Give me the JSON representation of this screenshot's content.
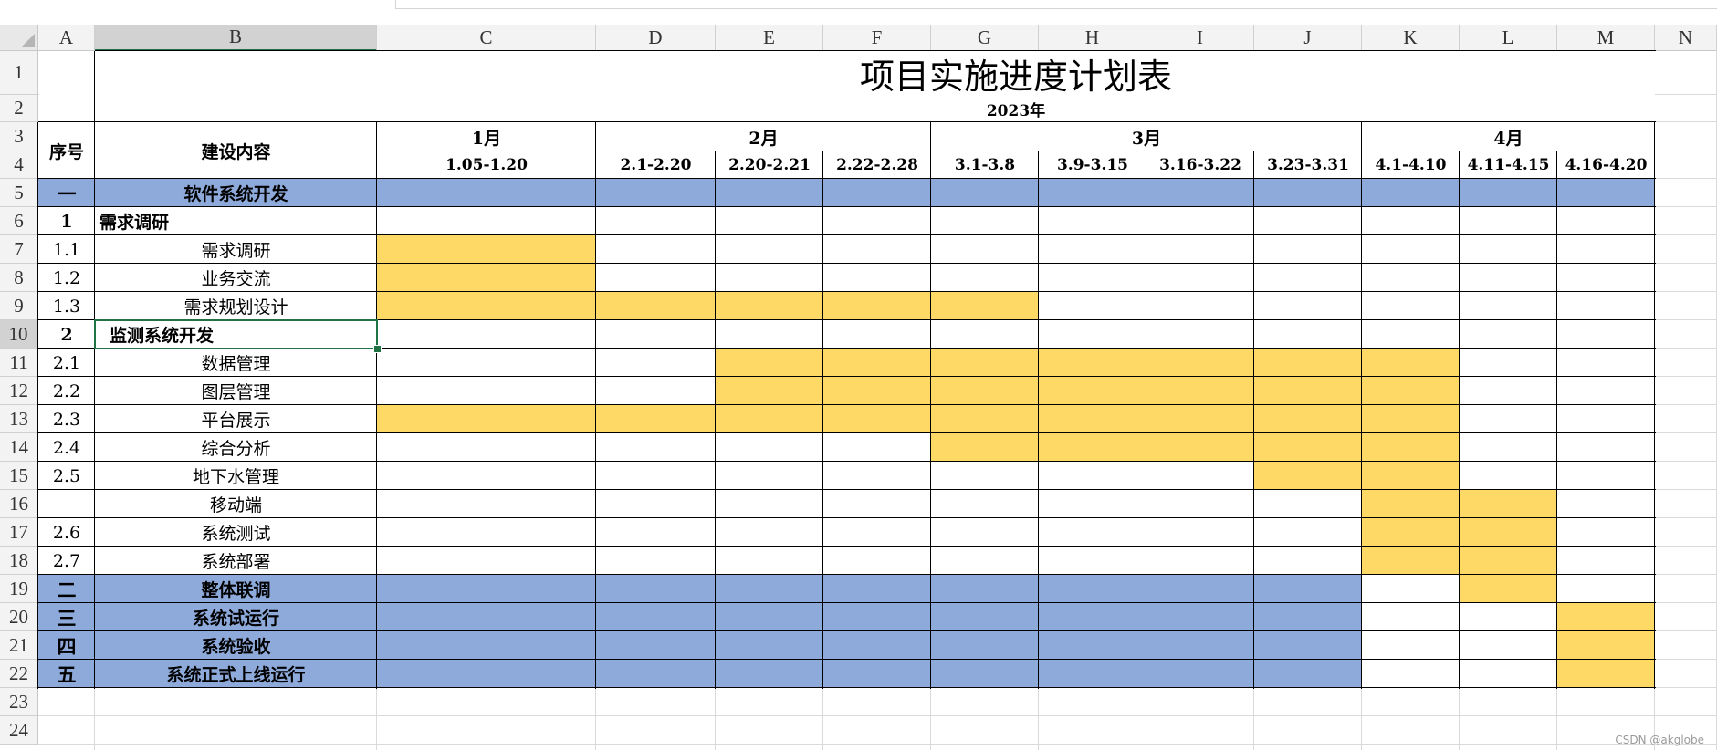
{
  "columns": [
    {
      "letter": "A"
    },
    {
      "letter": "B"
    },
    {
      "letter": "C"
    },
    {
      "letter": "D"
    },
    {
      "letter": "E"
    },
    {
      "letter": "F"
    },
    {
      "letter": "G"
    },
    {
      "letter": "H"
    },
    {
      "letter": "I"
    },
    {
      "letter": "J"
    },
    {
      "letter": "K"
    },
    {
      "letter": "L"
    },
    {
      "letter": "M"
    },
    {
      "letter": "N"
    }
  ],
  "row_numbers": [
    "1",
    "2",
    "3",
    "4",
    "5",
    "6",
    "7",
    "8",
    "9",
    "10",
    "11",
    "12",
    "13",
    "14",
    "15",
    "16",
    "17",
    "18",
    "19",
    "20",
    "21",
    "22",
    "23",
    "24"
  ],
  "selected": {
    "column": "B",
    "row": "10"
  },
  "sheet": {
    "title": "项目实施进度计划表",
    "year": "2023年",
    "headers": {
      "index": "序号",
      "content": "建设内容"
    },
    "months": [
      {
        "label": "1月",
        "col_start": 0,
        "col_end": 0
      },
      {
        "label": "2月",
        "col_start": 1,
        "col_end": 3
      },
      {
        "label": "3月",
        "col_start": 4,
        "col_end": 7
      },
      {
        "label": "4月",
        "col_start": 8,
        "col_end": 10
      }
    ],
    "periods": [
      "1.05-1.20",
      "2.1-2.20",
      "2.20-2.21",
      "2.22-2.28",
      "3.1-3.8",
      "3.9-3.15",
      "3.16-3.22",
      "3.23-3.31",
      "4.1-4.10",
      "4.11-4.15",
      "4.16-4.20"
    ],
    "tasks": [
      {
        "no": "一",
        "name": "软件系统开发",
        "type": "phase",
        "blue_periods": 11,
        "bars": []
      },
      {
        "no": "1",
        "name": "需求调研",
        "type": "group",
        "bars": []
      },
      {
        "no": "1.1",
        "name": "需求调研",
        "type": "task",
        "bars": [
          0,
          0
        ]
      },
      {
        "no": "1.2",
        "name": "业务交流",
        "type": "task",
        "bars": [
          0,
          0
        ]
      },
      {
        "no": "1.3",
        "name": "需求规划设计",
        "type": "task",
        "bars": [
          0,
          4
        ]
      },
      {
        "no": "2",
        "name": "监测系统开发",
        "type": "group",
        "bars": []
      },
      {
        "no": "2.1",
        "name": "数据管理",
        "type": "task",
        "bars": [
          2,
          8
        ]
      },
      {
        "no": "2.2",
        "name": "图层管理",
        "type": "task",
        "bars": [
          2,
          8
        ]
      },
      {
        "no": "2.3",
        "name": "平台展示",
        "type": "task",
        "bars": [
          0,
          8
        ]
      },
      {
        "no": "2.4",
        "name": "综合分析",
        "type": "task",
        "bars": [
          4,
          8
        ]
      },
      {
        "no": "2.5",
        "name": "地下水管理",
        "type": "task",
        "bars": [
          7,
          8
        ]
      },
      {
        "no": "",
        "name": "移动端",
        "type": "task",
        "bars": [
          8,
          9
        ]
      },
      {
        "no": "2.6",
        "name": "系统测试",
        "type": "task",
        "bars": [
          8,
          9
        ]
      },
      {
        "no": "2.7",
        "name": "系统部署",
        "type": "task",
        "bars": [
          8,
          9
        ]
      },
      {
        "no": "二",
        "name": "整体联调",
        "type": "phase",
        "blue_periods": 8,
        "bars": [
          9,
          9
        ]
      },
      {
        "no": "三",
        "name": "系统试运行",
        "type": "phase",
        "blue_periods": 8,
        "bars": [
          10,
          10
        ]
      },
      {
        "no": "四",
        "name": "系统验收",
        "type": "phase",
        "blue_periods": 8,
        "bars": [
          10,
          10
        ]
      },
      {
        "no": "五",
        "name": "系统正式上线运行",
        "type": "phase",
        "blue_periods": 8,
        "bars": [
          10,
          10
        ]
      }
    ]
  },
  "watermark": "CSDN @akglobe",
  "colors": {
    "phase_fill": "#8eaadb",
    "bar_fill": "#ffd966",
    "selection": "#217346"
  }
}
